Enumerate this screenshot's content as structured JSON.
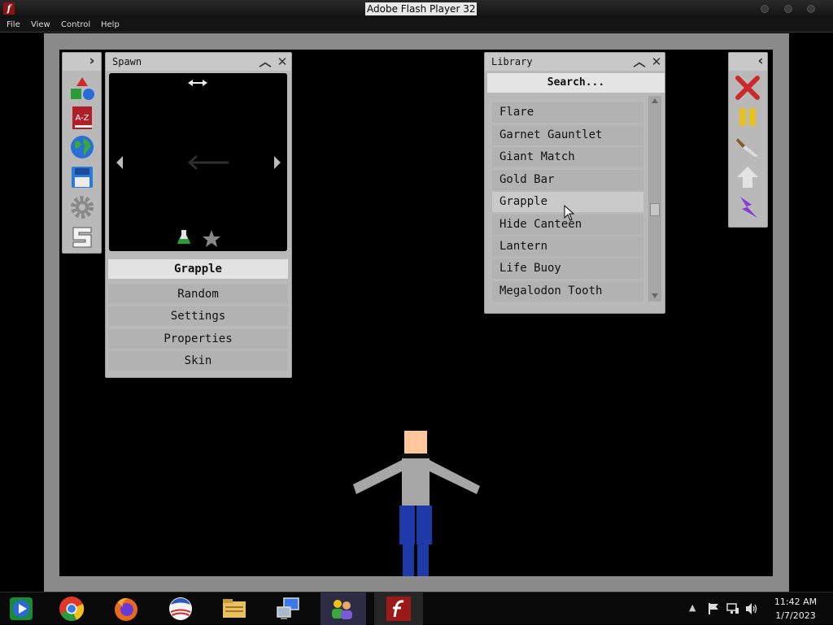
{
  "window": {
    "title": "Adobe Flash Player 32",
    "logo_glyph": "f"
  },
  "menubar": {
    "items": [
      "File",
      "View",
      "Control",
      "Help"
    ]
  },
  "toolbar_left": {
    "collapse_glyph": "›"
  },
  "spawn_panel": {
    "title": "Spawn",
    "selected_item": "Grapple",
    "menu": [
      "Random",
      "Settings",
      "Properties",
      "Skin"
    ],
    "preview_icons": [
      "flask-icon",
      "star-icon"
    ]
  },
  "library_panel": {
    "title": "Library",
    "search_placeholder": "Search...",
    "items": [
      "Flare",
      "Garnet Gauntlet",
      "Giant Match",
      "Gold Bar",
      "Grapple",
      "Hide Canteen",
      "Lantern",
      "Life Buoy",
      "Megalodon Tooth"
    ],
    "selected_index": 4
  },
  "toolbar_right": {
    "collapse_glyph": "‹"
  },
  "taskbar": {
    "apps": [
      "windows-media-icon",
      "chrome-icon",
      "firefox-icon",
      "obama-logo-icon",
      "file-explorer-icon",
      "remote-desktop-icon",
      "network-users-icon",
      "flash-player-icon"
    ],
    "clock_time": "11:42 AM",
    "clock_date": "1/7/2023"
  },
  "colors": {
    "panel": "#b9b9b9",
    "stage": "#000000",
    "close_red": "#cc2a2a",
    "pause_yellow": "#e8c020",
    "bolt_purple": "#8a3ad8"
  }
}
